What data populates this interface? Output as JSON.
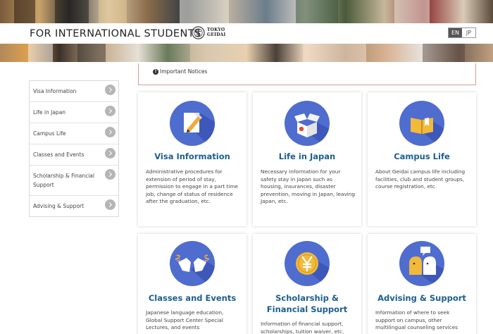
{
  "header": {
    "site_title": "FOR INTERNATIONAL STUDENTS",
    "logo_line1": "TOKYO",
    "logo_line2": "GEIDAI",
    "lang_en": "EN",
    "lang_jp": "JP"
  },
  "notice": {
    "icon": "exclamation-circle-icon",
    "label": "Important Notices"
  },
  "sidebar": {
    "items": [
      {
        "label": "Visa Information"
      },
      {
        "label": "Life in Japan"
      },
      {
        "label": "Campus Life"
      },
      {
        "label": "Classes and Events"
      },
      {
        "label": "Scholarship & Financial Support"
      },
      {
        "label": "Advising & Support"
      }
    ]
  },
  "cards": [
    {
      "icon": "document-pen-icon",
      "title": "Visa Information",
      "desc": "Administrative procedures for extension of period of stay, permission to engage in a part time job, change of status of residence after the graduation, etc."
    },
    {
      "icon": "open-box-icon",
      "title": "Life in Japan",
      "desc": "Necessary information for your safety stay in Japan such as housing, insurances, disaster prevention, moving in Japan, leaving Japan, etc."
    },
    {
      "icon": "book-icon",
      "title": "Campus Life",
      "desc": "About Geidai campus life including facilities, club and student groups, course registration, etc."
    },
    {
      "icon": "clapping-hands-icon",
      "title": "Classes and Events",
      "desc": "Japanese language education, Global Support Center Special Lectures, and events"
    },
    {
      "icon": "yen-coin-icon",
      "title": "Scholarship & Financial Support",
      "desc": "Information of financial support, scholarships, tuition waiver, etc."
    },
    {
      "icon": "consultation-icon",
      "title": "Advising & Support",
      "desc": "Information of where to seek support on campus, other multilingual counseling services"
    }
  ],
  "colors": {
    "accent_blue": "#4f6ccf",
    "title_blue": "#1c5f8e",
    "notice_border": "#d59a9a"
  }
}
